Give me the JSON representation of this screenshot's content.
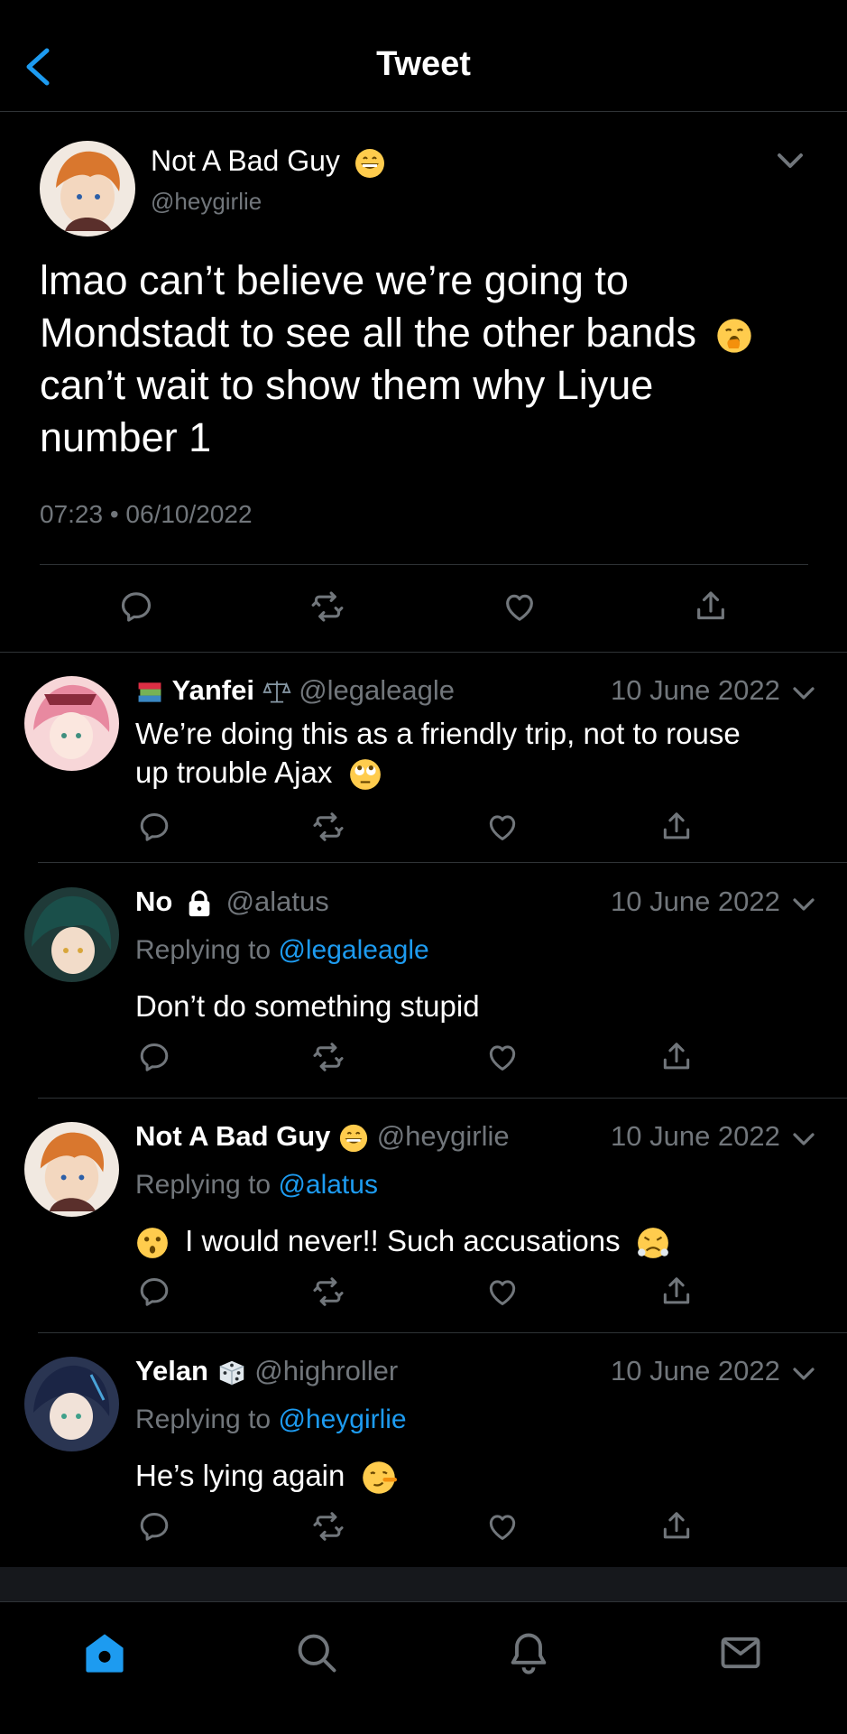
{
  "header": {
    "title": "Tweet"
  },
  "main_tweet": {
    "name": "Not A Bad Guy",
    "handle": "@heygirlie",
    "text_line1": "lmao can’t believe we’re going to",
    "text_line2": "Mondstadt to see all the other bands",
    "text_line3": "can’t wait to show them why Liyue",
    "text_line4": "number 1",
    "timestamp": "07:23 • 06/10/2022"
  },
  "replies": [
    {
      "name": "Yanfei",
      "handle": "@legaleagle",
      "date": "10 June 2022",
      "text_line1": "We’re doing this as a friendly trip, not to rouse",
      "text_line2": "up trouble Ajax"
    },
    {
      "name": "No",
      "handle": "@alatus",
      "date": "10 June 2022",
      "replying_prefix": "Replying to",
      "replying_to": "@legaleagle",
      "text": "Don’t do something stupid"
    },
    {
      "name": "Not A Bad Guy",
      "handle": "@heygirlie",
      "date": "10 June 2022",
      "replying_prefix": "Replying to",
      "replying_to": "@alatus",
      "text": "I would never!! Such accusations"
    },
    {
      "name": "Yelan",
      "handle": "@highroller",
      "date": "10 June 2022",
      "replying_prefix": "Replying to",
      "replying_to": "@heygirlie",
      "text": "He’s lying again"
    }
  ],
  "colors": {
    "accent": "#1d9bf0",
    "muted": "#71767b",
    "divider": "#2f3336"
  },
  "icons": [
    "back-arrow-icon",
    "chevron-down-icon",
    "reply-icon",
    "retweet-icon",
    "like-icon",
    "share-icon",
    "home-icon",
    "search-icon",
    "bell-icon",
    "mail-icon"
  ]
}
